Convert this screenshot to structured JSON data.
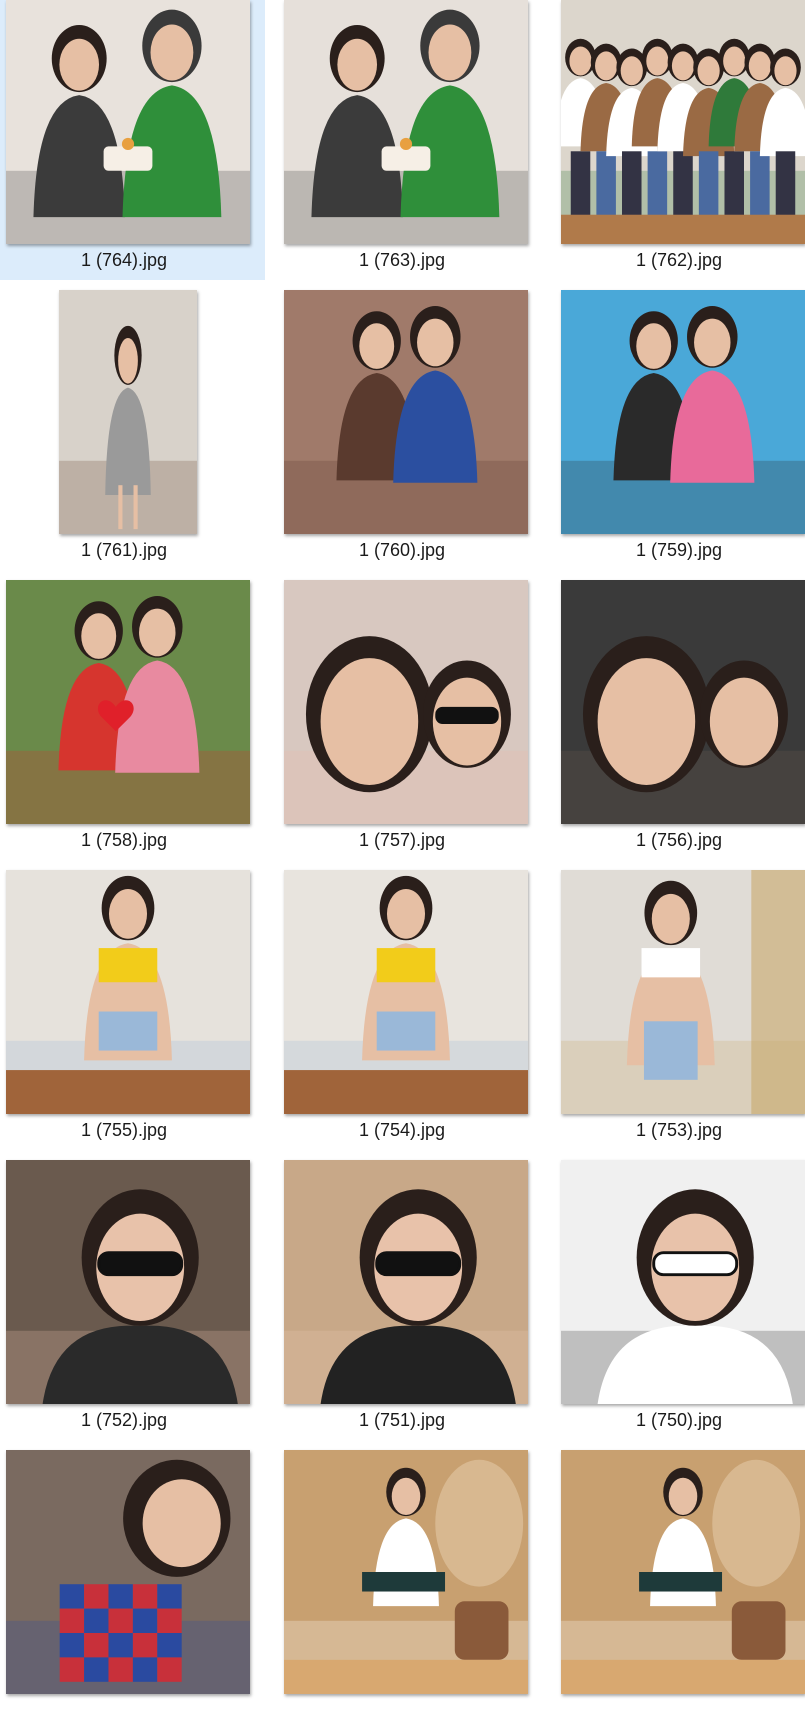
{
  "files": [
    {
      "name": "1 (764).jpg",
      "selected": true,
      "orientation": "landscape-square",
      "subject": "couple-with-cake",
      "palette": [
        "#e8e2dc",
        "#2f8f3a",
        "#3b3b3b"
      ]
    },
    {
      "name": "1 (763).jpg",
      "selected": false,
      "orientation": "landscape-square",
      "subject": "couple-with-cake",
      "palette": [
        "#e6e0da",
        "#2f8f3a",
        "#3b3b3b"
      ]
    },
    {
      "name": "1 (762).jpg",
      "selected": false,
      "orientation": "landscape-square",
      "subject": "group-photo",
      "palette": [
        "#dcd6cc",
        "#9a6a44",
        "#2f7a3a"
      ]
    },
    {
      "name": "1 (761).jpg",
      "selected": false,
      "orientation": "portrait",
      "subject": "woman-in-grey-blazer",
      "palette": [
        "#d8d2ca",
        "#9a9a9a",
        "#6b4b36"
      ]
    },
    {
      "name": "1 (760).jpg",
      "selected": false,
      "orientation": "landscape-square",
      "subject": "mother-daughter-hug",
      "palette": [
        "#a07a6a",
        "#2b4fa0",
        "#5a3a2e"
      ]
    },
    {
      "name": "1 (759).jpg",
      "selected": false,
      "orientation": "landscape-square",
      "subject": "poolside-hug",
      "palette": [
        "#4aa8d8",
        "#e86a9a",
        "#2a2a2a"
      ]
    },
    {
      "name": "1 (758).jpg",
      "selected": false,
      "orientation": "landscape-square",
      "subject": "kiss-on-cheek",
      "palette": [
        "#6a8a4a",
        "#e88aa0",
        "#d6352e"
      ]
    },
    {
      "name": "1 (757).jpg",
      "selected": false,
      "orientation": "landscape-square",
      "subject": "selfie-sunglasses",
      "palette": [
        "#d8c8c0",
        "#3a2a24",
        "#e8b8a8"
      ]
    },
    {
      "name": "1 (756).jpg",
      "selected": false,
      "orientation": "landscape-square",
      "subject": "car-selfie",
      "palette": [
        "#3a3a3a",
        "#e8c0a8",
        "#6a5a50"
      ]
    },
    {
      "name": "1 (755).jpg",
      "selected": false,
      "orientation": "landscape-square",
      "subject": "yellow-top-standing",
      "palette": [
        "#e6e2dc",
        "#f2cc1a",
        "#9ab8d8"
      ]
    },
    {
      "name": "1 (754).jpg",
      "selected": false,
      "orientation": "landscape-square",
      "subject": "yellow-top-sitting",
      "palette": [
        "#e8e4de",
        "#f2cc1a",
        "#9ab8d8"
      ]
    },
    {
      "name": "1 (753).jpg",
      "selected": false,
      "orientation": "landscape-square",
      "subject": "mirror-selfie",
      "palette": [
        "#e0dcd6",
        "#ffffff",
        "#c8a86a"
      ]
    },
    {
      "name": "1 (752).jpg",
      "selected": false,
      "orientation": "landscape-square",
      "subject": "leather-jacket-glasses",
      "palette": [
        "#6a5a4e",
        "#2a2a2a",
        "#e8c0aa"
      ]
    },
    {
      "name": "1 (751).jpg",
      "selected": false,
      "orientation": "landscape-square",
      "subject": "black-tee-sunglasses",
      "palette": [
        "#c8a888",
        "#222222",
        "#e8c8b0"
      ]
    },
    {
      "name": "1 (750).jpg",
      "selected": false,
      "orientation": "landscape-square",
      "subject": "white-shirt-sunglasses",
      "palette": [
        "#f0f0f0",
        "#ffffff",
        "#2a2a2a"
      ]
    },
    {
      "name": "",
      "selected": false,
      "orientation": "landscape-square",
      "subject": "patterned-top",
      "palette": [
        "#7a6a60",
        "#c8303a",
        "#2a4aa0"
      ]
    },
    {
      "name": "",
      "selected": false,
      "orientation": "landscape-square",
      "subject": "seated-on-chair",
      "palette": [
        "#c8a070",
        "#1e3a3a",
        "#ffffff"
      ]
    },
    {
      "name": "",
      "selected": false,
      "orientation": "landscape-square",
      "subject": "seated-on-chair",
      "palette": [
        "#c8a070",
        "#1e3a3a",
        "#ffffff"
      ]
    }
  ]
}
